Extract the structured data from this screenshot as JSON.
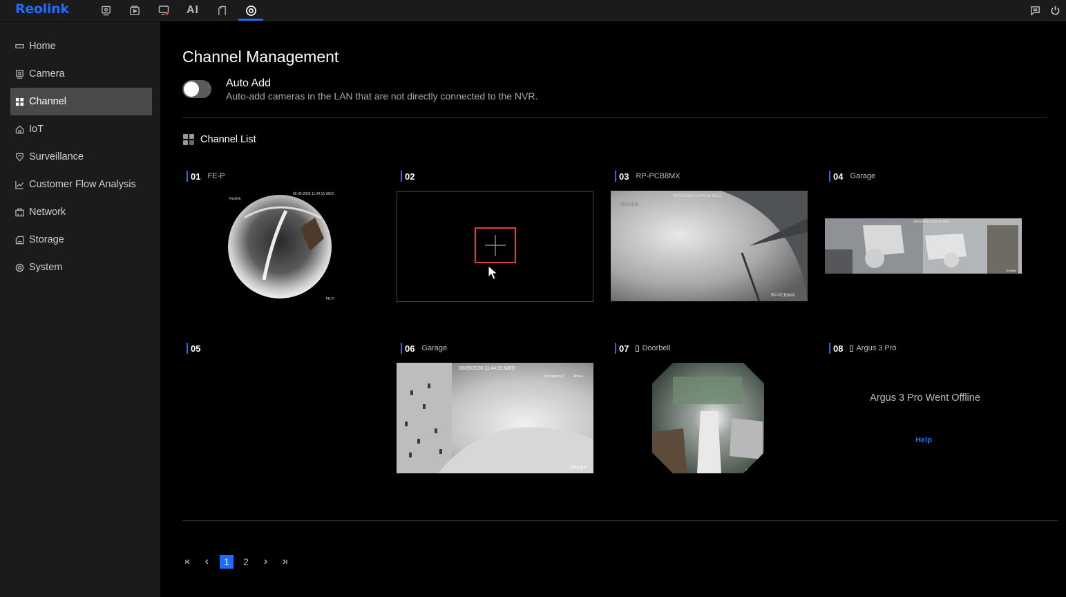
{
  "app": {
    "brand": "Reolink",
    "accent_color": "#1e6bff"
  },
  "topnav": [
    {
      "id": "live-view",
      "icon": "monitor-icon"
    },
    {
      "id": "playback",
      "icon": "playback-icon"
    },
    {
      "id": "alerts",
      "icon": "alert-screen-icon"
    },
    {
      "id": "ai",
      "label": "AI"
    },
    {
      "id": "smart",
      "icon": "phone-icon"
    },
    {
      "id": "settings",
      "icon": "gear-icon",
      "active": true
    }
  ],
  "topright": [
    {
      "icon": "message-icon"
    },
    {
      "icon": "power-icon"
    }
  ],
  "sidebar": {
    "items": [
      {
        "label": "Home",
        "icon": "home-icon"
      },
      {
        "label": "Camera",
        "icon": "camera-icon"
      },
      {
        "label": "Channel",
        "icon": "channel-grid-icon",
        "active": true
      },
      {
        "label": "IoT",
        "icon": "house-icon"
      },
      {
        "label": "Surveillance",
        "icon": "shield-icon"
      },
      {
        "label": "Customer Flow Analysis",
        "icon": "chart-icon"
      },
      {
        "label": "Network",
        "icon": "network-icon"
      },
      {
        "label": "Storage",
        "icon": "storage-icon"
      },
      {
        "label": "System",
        "icon": "system-icon"
      }
    ]
  },
  "main": {
    "title": "Channel Management",
    "auto_add": {
      "label": "Auto Add",
      "description": "Auto-add cameras in the LAN that are not directly connected to the NVR.",
      "enabled": false
    },
    "channel_list_title": "Channel List",
    "channels": [
      {
        "num": "01",
        "name": "FE-P",
        "view": "fisheye",
        "overlay_time": "06-05-2026 11:44:15 WED",
        "overlay_brand": "Reolink",
        "overlay_label": "FE-P"
      },
      {
        "num": "02",
        "name": "",
        "view": "empty"
      },
      {
        "num": "03",
        "name": "RP-PCB8MX",
        "view": "wide",
        "overlay_time": "06/05/2026 11:44:16 WED",
        "overlay_brand": "Reolink",
        "overlay_label": "RP-PCB8MX"
      },
      {
        "num": "04",
        "name": "Garage",
        "view": "panorama",
        "overlay_time": "06/05/2026 11:44:15 WED",
        "overlay_label": "Garage"
      },
      {
        "num": "05",
        "name": "",
        "view": "none"
      },
      {
        "num": "06",
        "name": "Garage",
        "view": "wide2",
        "overlay_time": "06/05/2026 11:44:15 WED",
        "overlay_extra1": "Occupancy 0",
        "overlay_extra2": "Area 1",
        "overlay_label": "Garage"
      },
      {
        "num": "07",
        "name": "Doorbell",
        "battery": true,
        "view": "doorbell",
        "overlay_label": "Doorbell"
      },
      {
        "num": "08",
        "name": "Argus 3 Pro",
        "battery": true,
        "view": "offline",
        "offline_message": "Argus 3 Pro Went Offline",
        "help_label": "Help"
      }
    ],
    "pagination": {
      "pages": [
        "1",
        "2"
      ],
      "current": 1
    }
  }
}
